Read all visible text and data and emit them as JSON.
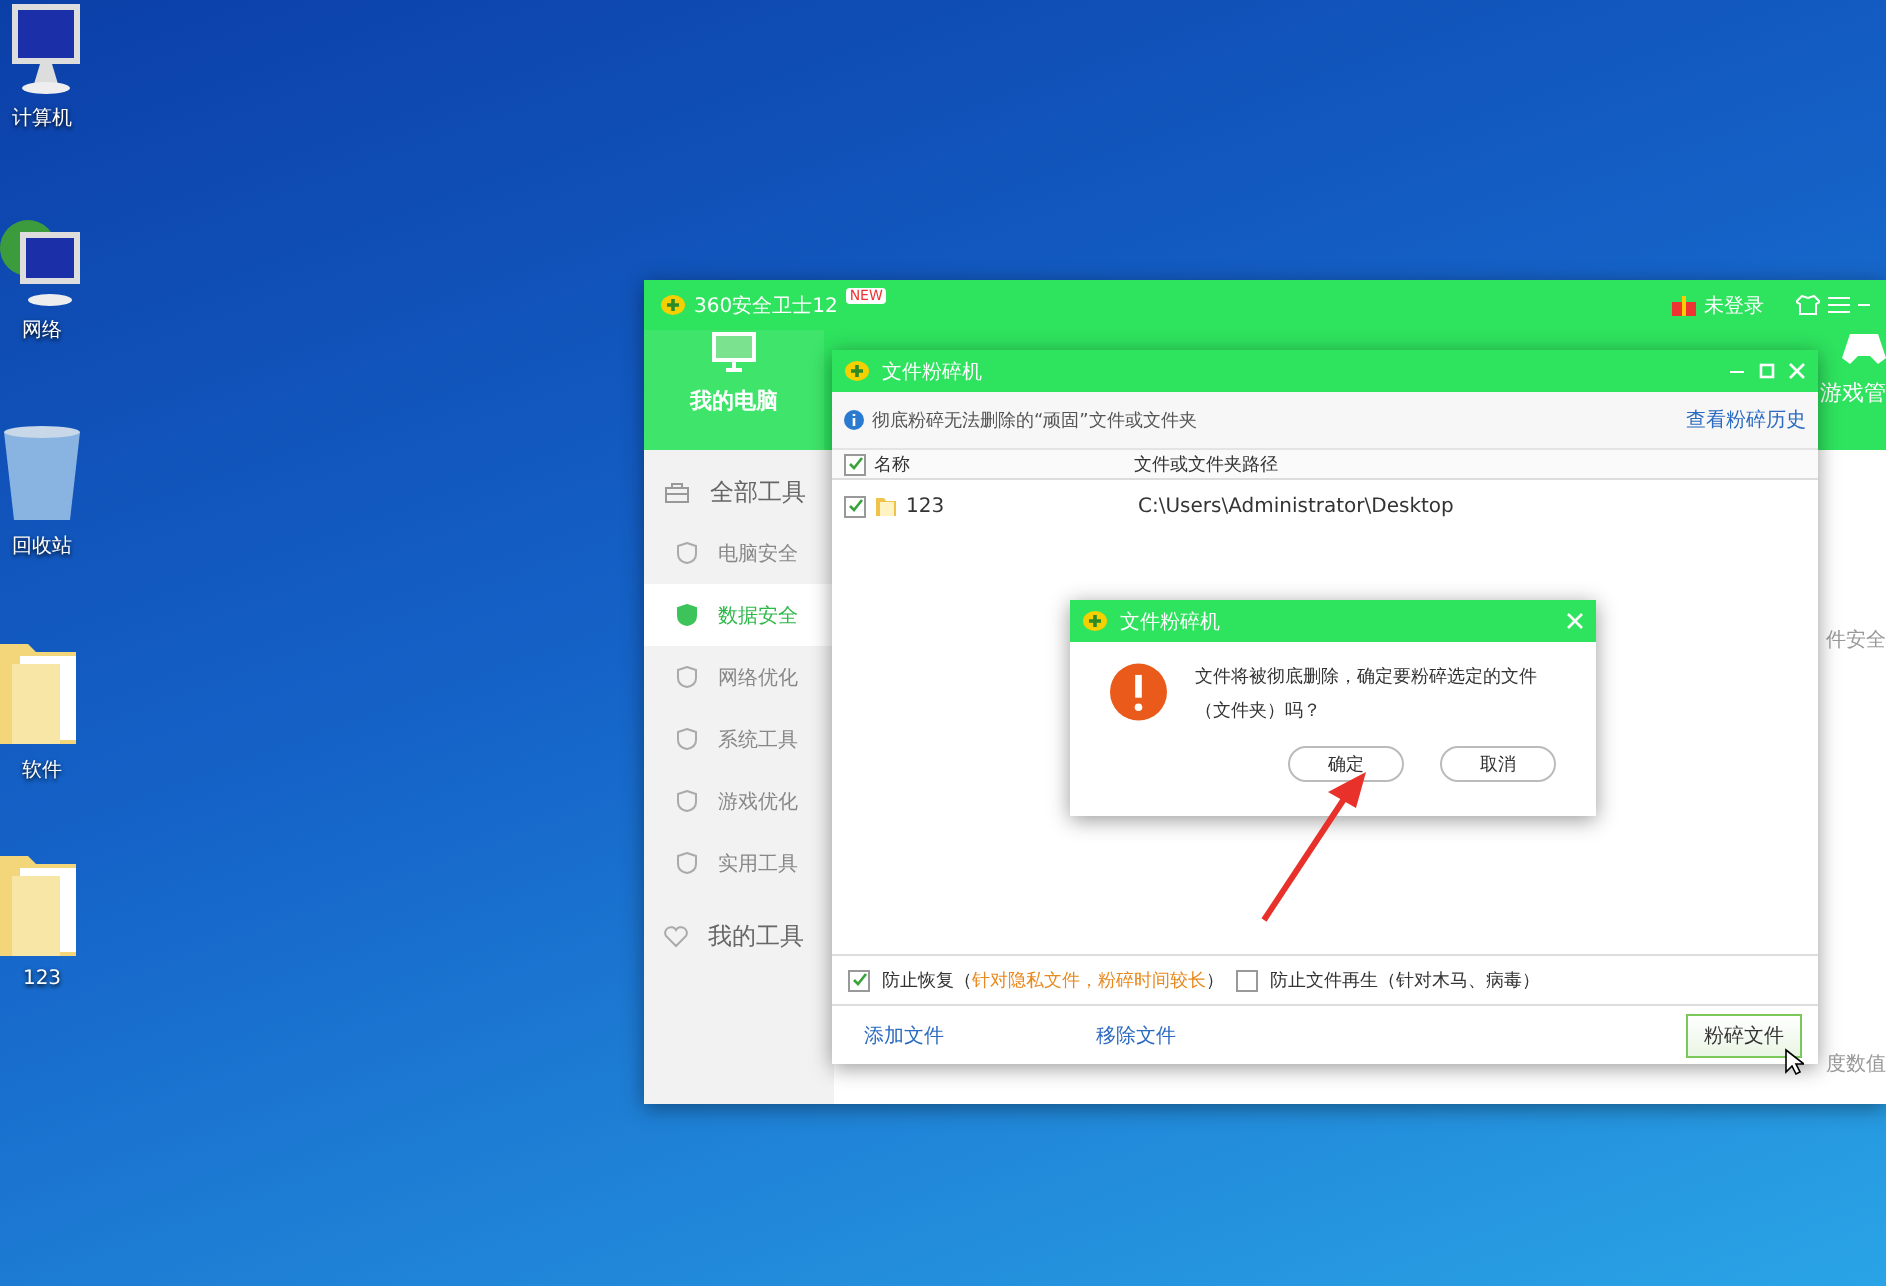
{
  "desktop_icons": [
    {
      "label": "计算机",
      "kind": "computer"
    },
    {
      "label": "网络",
      "kind": "network"
    },
    {
      "label": "回收站",
      "kind": "bin"
    },
    {
      "label": "软件",
      "kind": "folder"
    },
    {
      "label": "123",
      "kind": "folder"
    }
  ],
  "main_window": {
    "title": "360安全卫士12",
    "badge": "NEW",
    "user": "未登录",
    "nav": [
      {
        "label": "我的电脑",
        "selected": true
      },
      {
        "label": "游戏管",
        "selected": false
      }
    ],
    "sidebar": {
      "header": "全部工具",
      "items": [
        {
          "label": "电脑安全",
          "selected": false
        },
        {
          "label": "数据安全",
          "selected": true
        },
        {
          "label": "网络优化",
          "selected": false
        },
        {
          "label": "系统工具",
          "selected": false
        },
        {
          "label": "游戏优化",
          "selected": false
        },
        {
          "label": "实用工具",
          "selected": false
        }
      ],
      "footer": "我的工具"
    },
    "side_texts": [
      "件安全",
      "度数值"
    ]
  },
  "shredder": {
    "title": "文件粉碎机",
    "info": "彻底粉碎无法删除的“顽固”文件或文件夹",
    "history_link": "查看粉碎历史",
    "header_checked": true,
    "columns": [
      "名称",
      "文件或文件夹路径"
    ],
    "rows": [
      {
        "name": "123",
        "path": "C:\\Users\\Administrator\\Desktop",
        "checked": true
      }
    ],
    "options": [
      {
        "prefix": "防止恢复（",
        "note": "针对隐私文件，粉碎时间较长",
        "suffix": "）",
        "highlight": true,
        "checked": true
      },
      {
        "prefix": "防止文件再生（",
        "note": "针对木马、病毒",
        "suffix": "）",
        "highlight": false,
        "checked": false
      }
    ],
    "add": "添加文件",
    "remove": "移除文件",
    "shred_button": "粉碎文件"
  },
  "dialog": {
    "title": "文件粉碎机",
    "message": "文件将被彻底删除，确定要粉碎选定的文件（文件夹）吗？",
    "confirm": "确定",
    "cancel": "取消"
  }
}
